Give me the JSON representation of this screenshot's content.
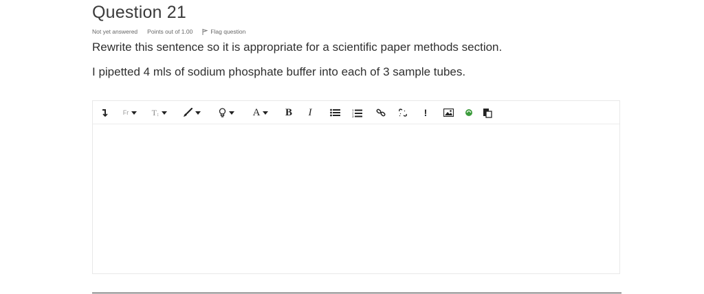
{
  "question": {
    "title": "Question 21",
    "status": "Not yet answered",
    "points": "Points out of 1.00",
    "flag_label": "Flag question",
    "prompt": "Rewrite this sentence so it is appropriate for a scientific paper methods section.",
    "sentence": "I pipetted 4 mls of sodium phosphate buffer into each of 3 sample tubes."
  },
  "toolbar": {
    "font_family_label": "Fr",
    "font_size_label": "T",
    "font_color_label": "A",
    "bold_label": "B",
    "italic_label": "I",
    "html_label": "!",
    "icons": [
      "collapse-icon",
      "font-family-dropdown",
      "font-size-dropdown",
      "brush-icon",
      "lightbulb-icon",
      "font-color-dropdown",
      "bold-icon",
      "italic-icon",
      "unordered-list-icon",
      "ordered-list-icon",
      "link-icon",
      "unlink-icon",
      "html-icon",
      "image-icon",
      "recycle-icon",
      "paste-icon"
    ]
  },
  "editor": {
    "content": ""
  }
}
